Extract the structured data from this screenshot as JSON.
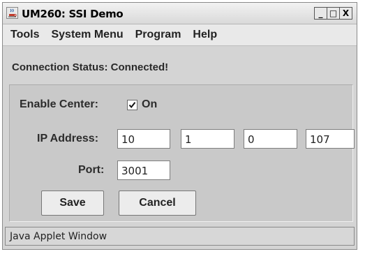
{
  "window": {
    "title": "UM260: SSI Demo",
    "controls": {
      "minimize": "_",
      "maximize": "□",
      "close": "X"
    }
  },
  "menu": [
    "Tools",
    "System Menu",
    "Program",
    "Help"
  ],
  "status": {
    "text": "Connection Status: Connected!"
  },
  "form": {
    "enable_center": {
      "label": "Enable Center:",
      "checked": true,
      "option_label": "On"
    },
    "ip_address": {
      "label": "IP Address:",
      "octets": [
        "10",
        "1",
        "0",
        "107"
      ]
    },
    "port": {
      "label": "Port:",
      "value": "3001"
    },
    "save_label": "Save",
    "cancel_label": "Cancel"
  },
  "statusbar": {
    "text": "Java Applet Window"
  },
  "icons": {
    "app": "java-cup-icon",
    "check": "checkmark-icon"
  }
}
